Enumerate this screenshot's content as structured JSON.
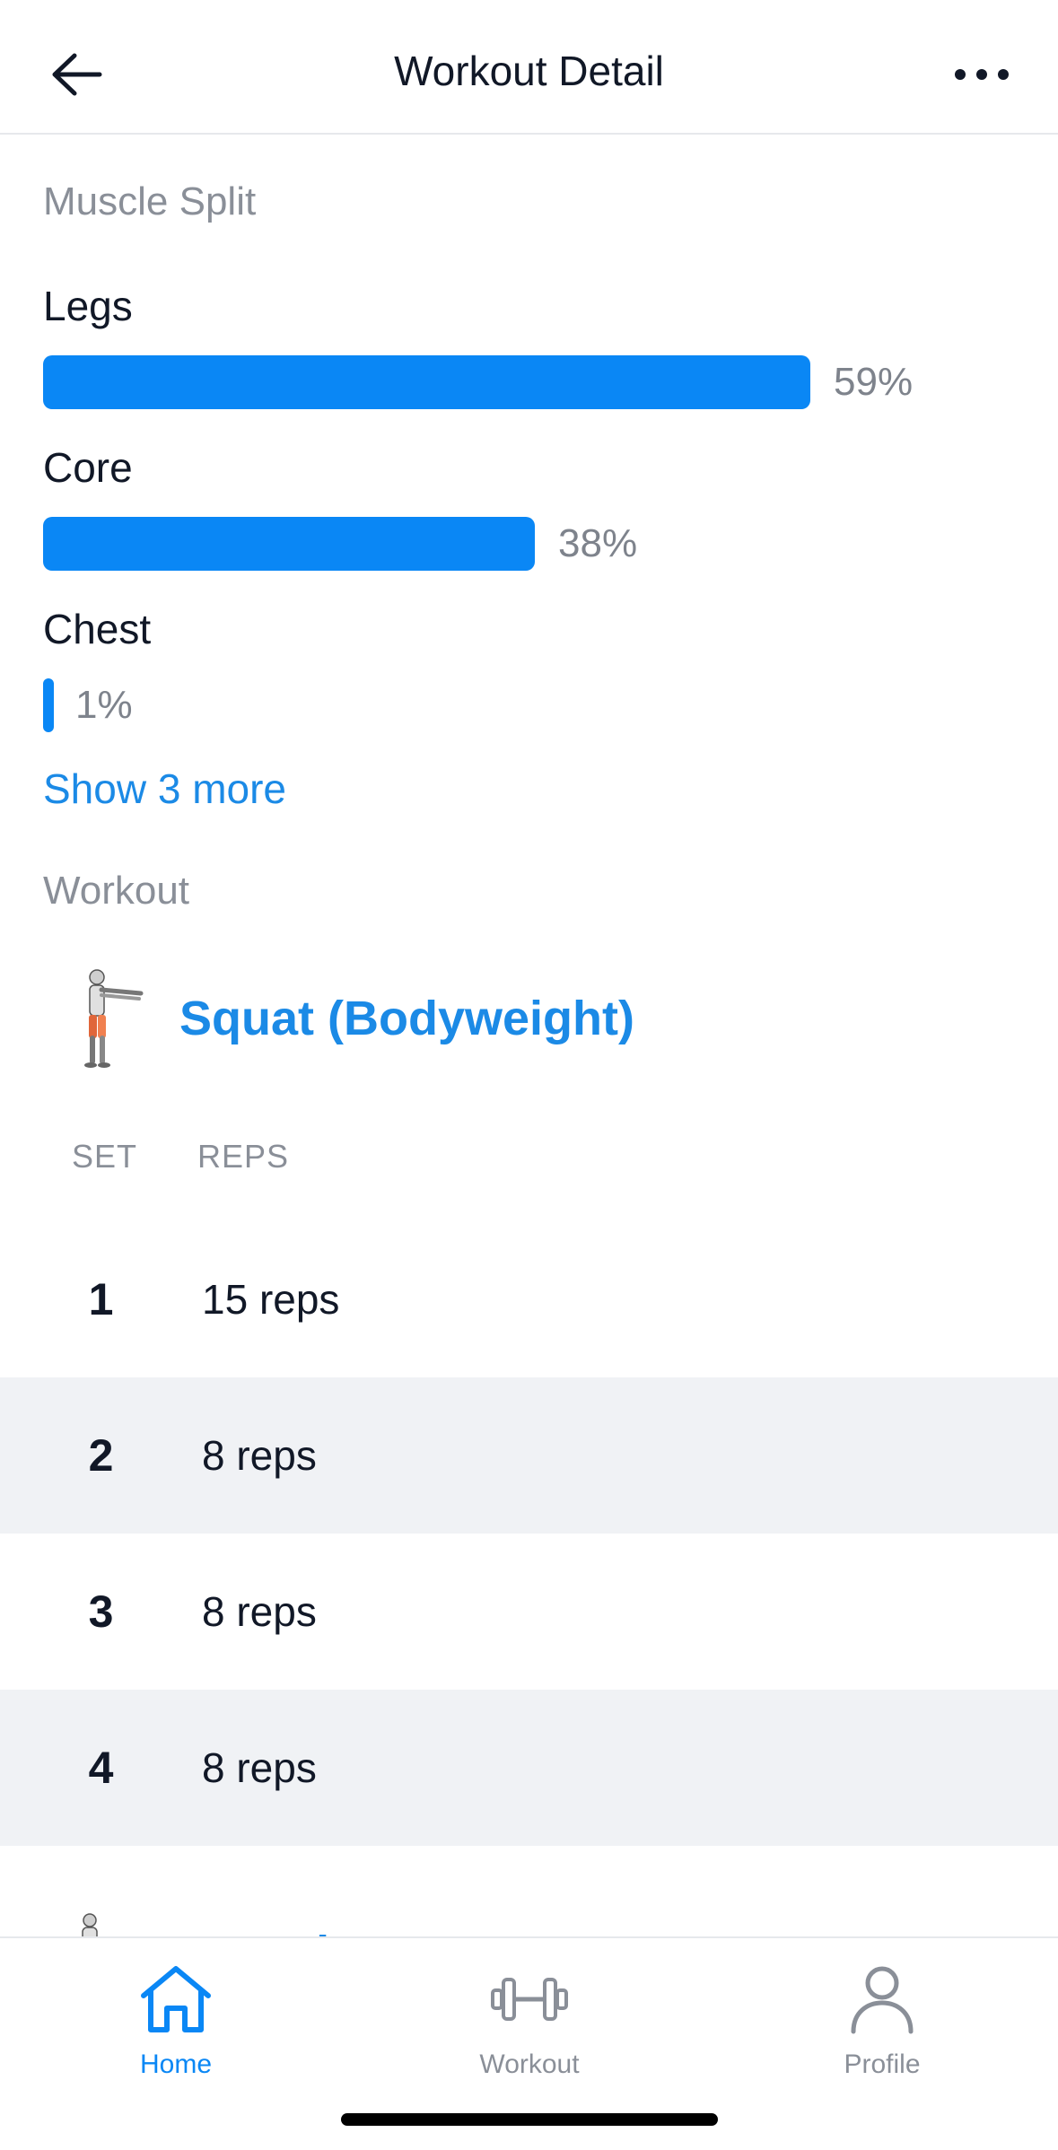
{
  "header": {
    "title": "Workout Detail",
    "back_icon": "arrow-left-icon",
    "more_icon": "more-horizontal-icon"
  },
  "muscle_split": {
    "label": "Muscle Split",
    "items": [
      {
        "name": "Legs",
        "percent_label": "59%",
        "percent": 59
      },
      {
        "name": "Core",
        "percent_label": "38%",
        "percent": 38
      },
      {
        "name": "Chest",
        "percent_label": "1%",
        "percent": 1
      }
    ],
    "show_more": "Show 3 more"
  },
  "workout": {
    "label": "Workout",
    "exercise": {
      "name": "Squat (Bodyweight)",
      "thumbnail_icon": "squat-figure-icon"
    },
    "columns": {
      "set": "SET",
      "reps": "REPS"
    },
    "sets": [
      {
        "set": "1",
        "reps": "15 reps"
      },
      {
        "set": "2",
        "reps": "8 reps"
      },
      {
        "set": "3",
        "reps": "8 reps"
      },
      {
        "set": "4",
        "reps": "8 reps"
      }
    ],
    "next_exercise": {
      "name": "Lateral Lunge"
    }
  },
  "tabbar": {
    "tabs": [
      {
        "label": "Home",
        "icon": "home-icon",
        "active": true
      },
      {
        "label": "Workout",
        "icon": "dumbbell-icon",
        "active": false
      },
      {
        "label": "Profile",
        "icon": "person-icon",
        "active": false
      }
    ]
  },
  "colors": {
    "accent": "#0A87F5",
    "link": "#1B8AE6",
    "muted": "#8A8F98",
    "row_alt": "#F0F2F5"
  }
}
